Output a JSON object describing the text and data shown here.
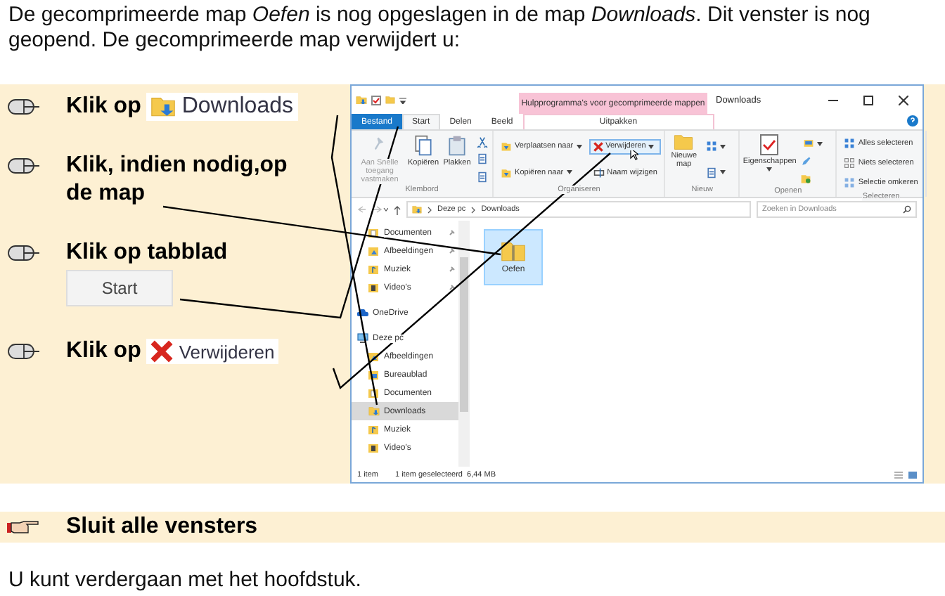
{
  "intro": "De gecomprimeerde map *Oefen* is nog opgeslagen in de map *Downloads*. Dit venster is nog geopend. De gecomprimeerde map verwijdert u:",
  "steps": [
    {
      "text": "Klik op",
      "target": {
        "kind": "folder",
        "label": "Downloads"
      }
    },
    {
      "text": "Klik, indien nodig,op de map"
    },
    {
      "text": "Klik op tabblad",
      "target": {
        "kind": "tab",
        "label": "Start"
      }
    },
    {
      "text": "Klik op",
      "target": {
        "kind": "delete",
        "label": "Verwijderen"
      }
    }
  ],
  "explorer": {
    "context_header": "Hulpprogramma's voor gecomprimeerde mappen",
    "title": "Downloads",
    "tabs": [
      {
        "label": "Bestand",
        "kind": "file",
        "selected": false
      },
      {
        "label": "Start",
        "kind": "normal",
        "selected": true
      },
      {
        "label": "Delen",
        "kind": "normal",
        "selected": false
      },
      {
        "label": "Beeld",
        "kind": "normal",
        "selected": false
      },
      {
        "label": "Uitpakken",
        "kind": "context",
        "selected": false
      }
    ],
    "ribbon": [
      {
        "label": "Klembord",
        "items": [
          {
            "kind": "large",
            "label": "Aan Snelle toegang vastmaken",
            "disabled": true
          },
          {
            "kind": "large",
            "label": "Kopiëren",
            "disabled": false
          },
          {
            "kind": "large",
            "label": "Plakken",
            "disabled": false
          },
          {
            "kind": "stack",
            "items": [
              {
                "kind": "icon"
              },
              {
                "kind": "icon"
              },
              {
                "kind": "icon"
              }
            ]
          }
        ]
      },
      {
        "label": "Organiseren",
        "items": [
          {
            "kind": "stack",
            "items": [
              {
                "label": "Verplaatsen naar",
                "dropdown": true
              },
              {
                "label": "Kopiëren naar",
                "dropdown": true
              }
            ]
          },
          {
            "kind": "stack",
            "items": [
              {
                "label": "Verwijderen",
                "dropdown": true,
                "highlighted": true
              },
              {
                "label": "Naam wijzigen",
                "dropdown": false
              }
            ]
          }
        ]
      },
      {
        "label": "Nieuw",
        "items": [
          {
            "kind": "large",
            "label": "Nieuwe map",
            "disabled": false
          },
          {
            "kind": "stack",
            "items": [
              {
                "dropdown": true
              },
              {
                "dropdown": true
              }
            ]
          }
        ]
      },
      {
        "label": "Openen",
        "items": [
          {
            "kind": "large",
            "label": "Eigenschappen",
            "disabled": false,
            "dropdown": true
          },
          {
            "kind": "stack",
            "items": [
              {
                "dropdown": true
              },
              {
                "kind": "icon"
              },
              {
                "kind": "icon"
              }
            ]
          }
        ]
      },
      {
        "label": "Selecteren",
        "items": [
          {
            "kind": "stack",
            "items": [
              {
                "label": "Alles selecteren"
              },
              {
                "label": "Niets selecteren"
              },
              {
                "label": "Selectie omkeren"
              }
            ]
          }
        ]
      }
    ],
    "path": [
      "Deze pc",
      "Downloads"
    ],
    "search": {
      "placeholder": "Zoeken in Downloads"
    },
    "quick_access": [
      {
        "label": "Documenten",
        "kind": "documents",
        "selected": false
      },
      {
        "label": "Afbeeldingen",
        "kind": "pictures",
        "selected": false
      },
      {
        "label": "Muziek",
        "kind": "music",
        "selected": false
      },
      {
        "label": "Video's",
        "kind": "videos",
        "selected": false
      }
    ],
    "roots": [
      {
        "label": "OneDrive",
        "kind": "cloud",
        "selected": false
      },
      {
        "label": "Deze pc",
        "kind": "computer",
        "selected": false,
        "children": [
          {
            "label": "Afbeeldingen",
            "kind": "pictures",
            "selected": false
          },
          {
            "label": "Bureaublad",
            "kind": "desktop",
            "selected": false
          },
          {
            "label": "Documenten",
            "kind": "documents",
            "selected": false
          },
          {
            "label": "Downloads",
            "kind": "downloads",
            "selected": true
          },
          {
            "label": "Muziek",
            "kind": "music",
            "selected": false
          },
          {
            "label": "Video's",
            "kind": "videos",
            "selected": false
          }
        ]
      }
    ],
    "files": [
      {
        "name": "Oefen",
        "selected": true
      }
    ],
    "status": [
      "1 item",
      "1 item geselecteerd  6,44 MB"
    ]
  },
  "note": "Sluit alle vensters",
  "outro": "U kunt verdergaan met het hoofdstuk."
}
